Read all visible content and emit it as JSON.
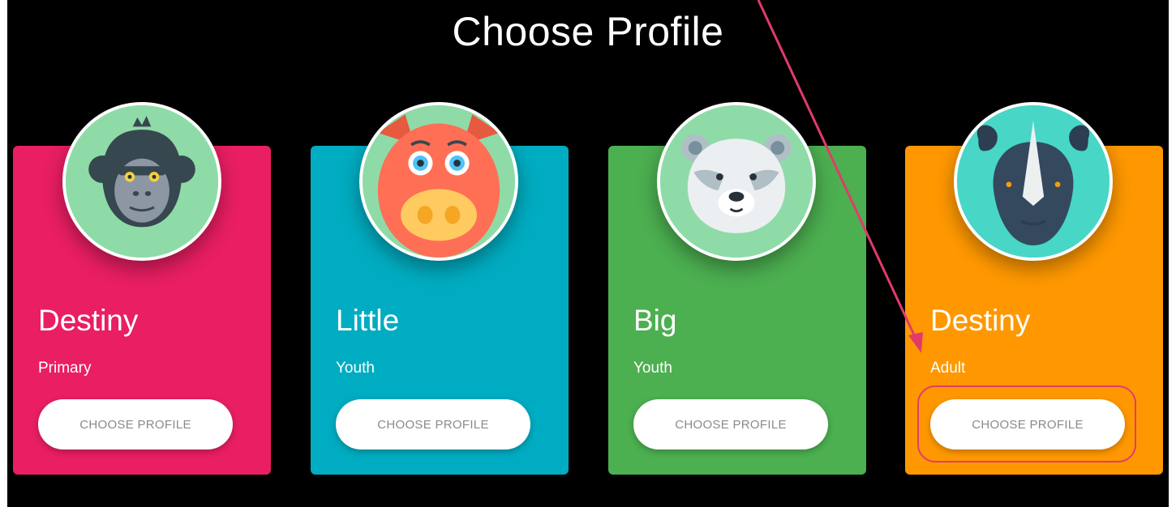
{
  "page": {
    "title": "Choose Profile"
  },
  "profiles": [
    {
      "name": "Destiny",
      "role": "Primary",
      "button_label": "CHOOSE PROFILE",
      "color": "#E91E63",
      "avatar_icon": "gorilla-icon",
      "avatar_bg": "#8FDBA8"
    },
    {
      "name": "Little",
      "role": "Youth",
      "button_label": "CHOOSE PROFILE",
      "color": "#00ACC1",
      "avatar_icon": "pig-icon",
      "avatar_bg": "#8FDBA8"
    },
    {
      "name": "Big",
      "role": "Youth",
      "button_label": "CHOOSE PROFILE",
      "color": "#4CAF50",
      "avatar_icon": "bear-icon",
      "avatar_bg": "#8FDBA8"
    },
    {
      "name": "Destiny",
      "role": "Adult",
      "button_label": "CHOOSE PROFILE",
      "color": "#FF9800",
      "avatar_icon": "rhino-icon",
      "avatar_bg": "#48D6C6"
    }
  ],
  "annotation": {
    "arrow_color": "#E23B6A"
  }
}
